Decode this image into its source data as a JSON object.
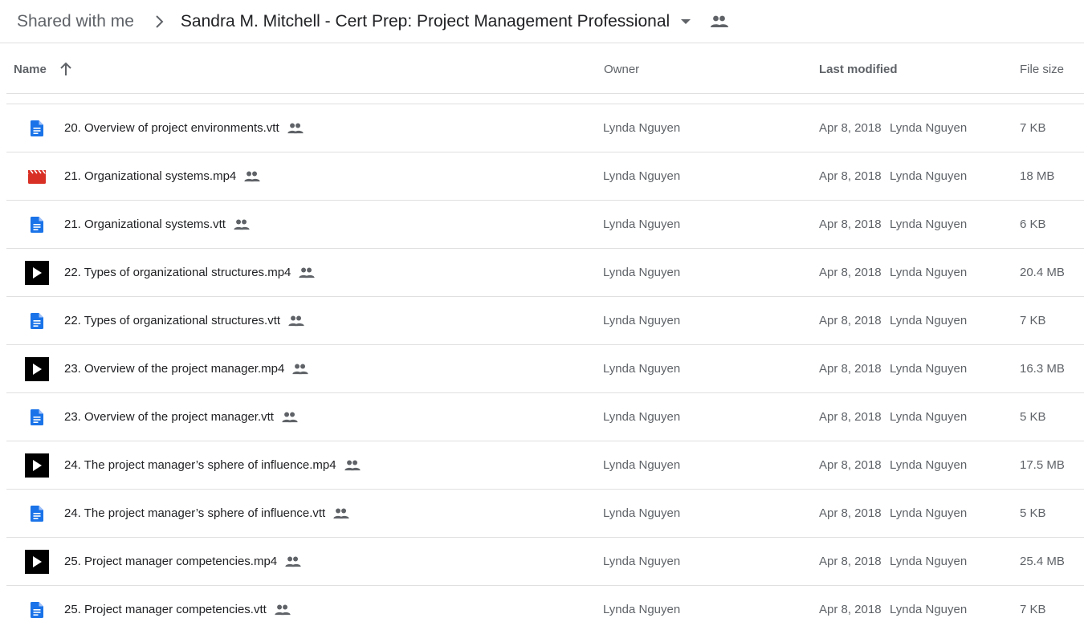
{
  "breadcrumb": {
    "root": "Shared with me",
    "current": "Sandra M. Mitchell - Cert Prep: Project Management Professional"
  },
  "columns": {
    "name": "Name",
    "owner": "Owner",
    "last_modified": "Last modified",
    "file_size": "File size"
  },
  "files": [
    {
      "name": "20. Overview of project environments.vtt",
      "icon": "doc-icon",
      "owner": "Lynda Nguyen",
      "date": "Apr 8, 2018",
      "modified_by": "Lynda Nguyen",
      "size": "7 KB"
    },
    {
      "name": "21. Organizational systems.mp4",
      "icon": "clapperboard-icon",
      "owner": "Lynda Nguyen",
      "date": "Apr 8, 2018",
      "modified_by": "Lynda Nguyen",
      "size": "18 MB"
    },
    {
      "name": "21. Organizational systems.vtt",
      "icon": "doc-icon",
      "owner": "Lynda Nguyen",
      "date": "Apr 8, 2018",
      "modified_by": "Lynda Nguyen",
      "size": "6 KB"
    },
    {
      "name": "22. Types of organizational structures.mp4",
      "icon": "video-play-icon",
      "owner": "Lynda Nguyen",
      "date": "Apr 8, 2018",
      "modified_by": "Lynda Nguyen",
      "size": "20.4 MB"
    },
    {
      "name": "22. Types of organizational structures.vtt",
      "icon": "doc-icon",
      "owner": "Lynda Nguyen",
      "date": "Apr 8, 2018",
      "modified_by": "Lynda Nguyen",
      "size": "7 KB"
    },
    {
      "name": "23. Overview of the project manager.mp4",
      "icon": "video-play-icon",
      "owner": "Lynda Nguyen",
      "date": "Apr 8, 2018",
      "modified_by": "Lynda Nguyen",
      "size": "16.3 MB"
    },
    {
      "name": "23. Overview of the project manager.vtt",
      "icon": "doc-icon",
      "owner": "Lynda Nguyen",
      "date": "Apr 8, 2018",
      "modified_by": "Lynda Nguyen",
      "size": "5 KB"
    },
    {
      "name": "24. The project manager’s sphere of influence.mp4",
      "icon": "video-play-icon",
      "owner": "Lynda Nguyen",
      "date": "Apr 8, 2018",
      "modified_by": "Lynda Nguyen",
      "size": "17.5 MB"
    },
    {
      "name": "24. The project manager’s sphere of influence.vtt",
      "icon": "doc-icon",
      "owner": "Lynda Nguyen",
      "date": "Apr 8, 2018",
      "modified_by": "Lynda Nguyen",
      "size": "5 KB"
    },
    {
      "name": "25. Project manager competencies.mp4",
      "icon": "video-play-icon",
      "owner": "Lynda Nguyen",
      "date": "Apr 8, 2018",
      "modified_by": "Lynda Nguyen",
      "size": "25.4 MB"
    },
    {
      "name": "25. Project manager competencies.vtt",
      "icon": "doc-icon",
      "owner": "Lynda Nguyen",
      "date": "Apr 8, 2018",
      "modified_by": "Lynda Nguyen",
      "size": "7 KB"
    }
  ],
  "colors": {
    "doc_blue": "#1a73e8",
    "video_red": "#d93025",
    "text_gray": "#5f6368"
  }
}
